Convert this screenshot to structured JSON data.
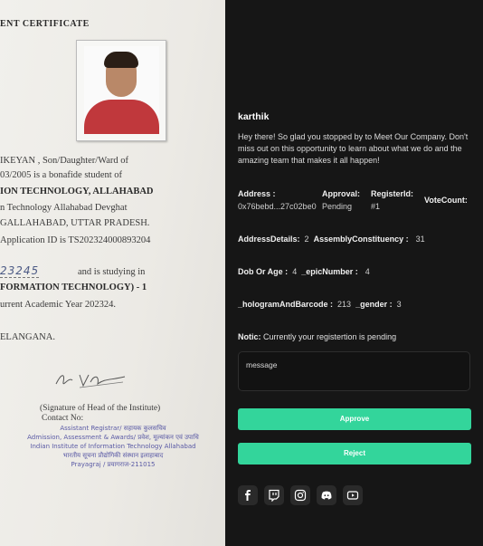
{
  "certificate": {
    "title": "ENT CERTIFICATE",
    "lines": [
      "IKEYAN , Son/Daughter/Ward of",
      "03/2005 is a bonafide student of",
      "ION TECHNOLOGY, ALLAHABAD",
      "n Technology Allahabad Devghat",
      "GALLAHABAD, UTTAR PRADESH.",
      "Application ID is TS202324000893204",
      "and is studying in",
      "FORMATION TECHNOLOGY) - 1",
      "urrent Academic Year 202324.",
      "ELANGANA."
    ],
    "handwritten_number": "23245",
    "signature_caption": "(Signature of Head of the Institute)",
    "contact_label": "Contact No:",
    "stamp": [
      "Assistant Registrar/ सहायक कुलसचिव",
      "Admission, Assessment & Awards/ प्रवेश, मूल्यांकन एवं उपाधि",
      "Indian Institute of Information Technology Allahabad",
      "भारतीय सूचना प्रौद्योगिकी संस्थान इलाहाबाद",
      "Prayagraj / प्रयागराज-211015"
    ]
  },
  "panel": {
    "user_name": "karthik",
    "description": "Hey there! So glad you stopped by to Meet Our Company. Don't miss out on this opportunity to learn about what we do and the amazing team that makes it all happen!",
    "fields": {
      "address_label": "Address :",
      "address_value": "0x76bebd...27c02be0",
      "approval_label": "Approval:",
      "approval_value": "Pending",
      "register_label": "RegisterId:",
      "register_value": "#1",
      "votecount_label": "VoteCount:",
      "address_details_label": "AddressDetails:",
      "address_details_value": "2",
      "assembly_label": "AssemblyConstituency :",
      "assembly_value": "31",
      "dob_label": "Dob Or Age :",
      "dob_value": "4",
      "epic_label": "_epicNumber :",
      "epic_value": "4",
      "hologram_label": "_hologramAndBarcode :",
      "hologram_value": "213",
      "gender_label": "_gender :",
      "gender_value": "3"
    },
    "notic_label": "Notic:",
    "notic_text": "Currently your registertion is pending",
    "message_placeholder": "message",
    "approve_label": "Approve",
    "reject_label": "Reject",
    "accent_color": "#33d59b",
    "social_icons": [
      "facebook-icon",
      "twitch-icon",
      "instagram-icon",
      "discord-icon",
      "youtube-icon"
    ]
  }
}
